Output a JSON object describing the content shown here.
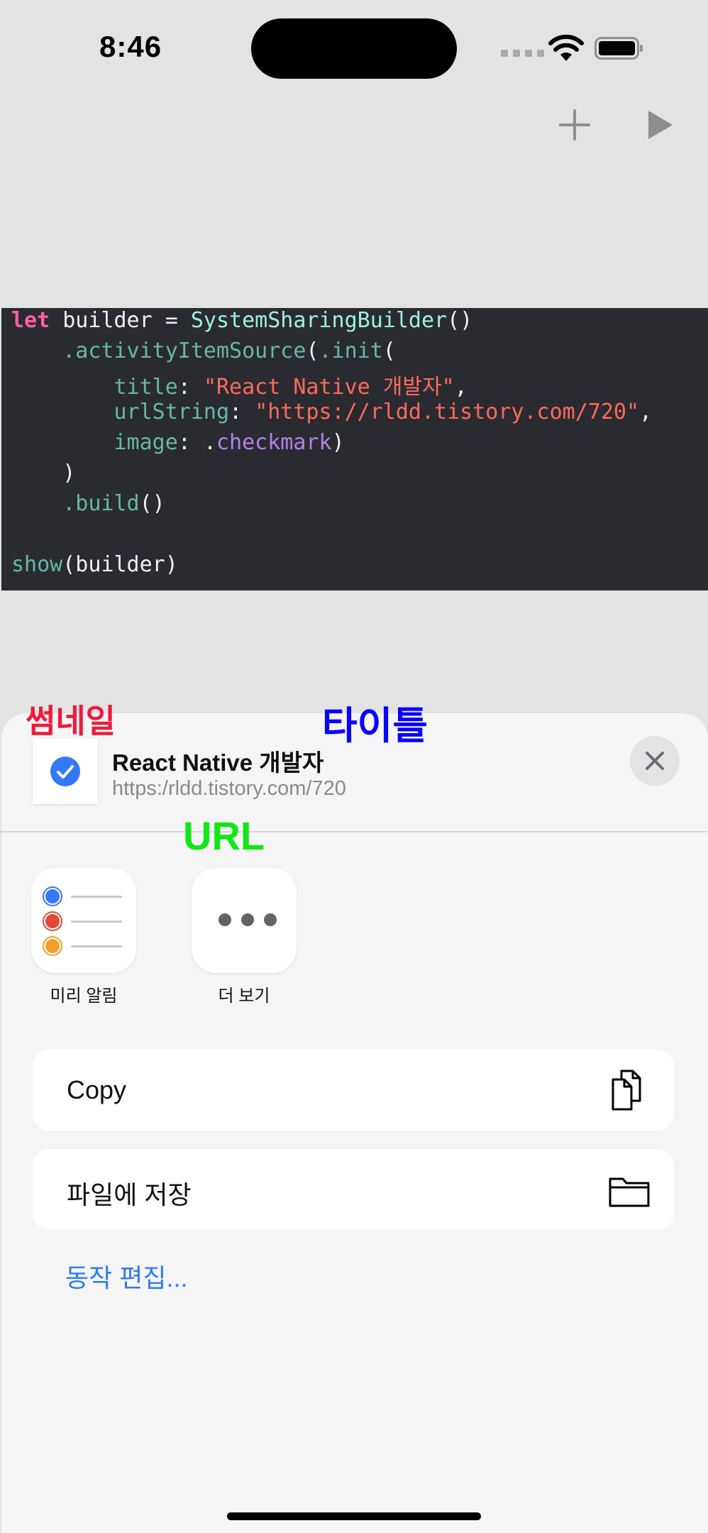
{
  "status_bar": {
    "time": "8:46"
  },
  "toolbar": {
    "add_icon": "plus-icon",
    "run_icon": "play-icon"
  },
  "code": {
    "line1": {
      "kw": "let",
      "text1": " builder = ",
      "type": "SystemSharingBuilder",
      "text2": "()"
    },
    "line2": {
      "indent": "    ",
      "fn1": ".activityItemSource",
      "p1": "(",
      "fn2": ".init",
      "p2": "("
    },
    "line3": {
      "indent": "        ",
      "key": "title",
      "colon": ": ",
      "value": "\"React Native 개발자\"",
      "comma": ","
    },
    "line4": {
      "indent": "        ",
      "key": "urlString",
      "colon": ": ",
      "value": "\"https://rldd.tistory.com/720\"",
      "comma": ","
    },
    "line5": {
      "indent": "        ",
      "key": "image",
      "colon": ": ",
      "dot": ".",
      "value": "checkmark",
      "close": ")"
    },
    "line6": {
      "indent": "    ",
      "text": ")"
    },
    "line7": {
      "indent": "    ",
      "fn": ".build",
      "text": "()"
    },
    "line9": {
      "fn": "show",
      "text": "(builder)"
    }
  },
  "annotations": {
    "thumbnail": "썸네일",
    "title": "타이틀",
    "url": "URL"
  },
  "share_sheet": {
    "title": "React Native 개발자",
    "url": "https:/rldd.tistory.com/720",
    "apps": [
      {
        "label": "미리 알림",
        "icon": "reminders-icon"
      },
      {
        "label": "더 보기",
        "icon": "more-icon"
      }
    ],
    "actions": [
      {
        "label": "Copy",
        "icon": "copy-icon"
      },
      {
        "label": "파일에 저장",
        "icon": "folder-icon"
      }
    ],
    "edit_actions": "동작 편집..."
  },
  "colors": {
    "accent": "#2e7cf6",
    "annotation_thumbnail": "#f0193c",
    "annotation_title": "#0a00ff",
    "annotation_url": "#10e814"
  }
}
